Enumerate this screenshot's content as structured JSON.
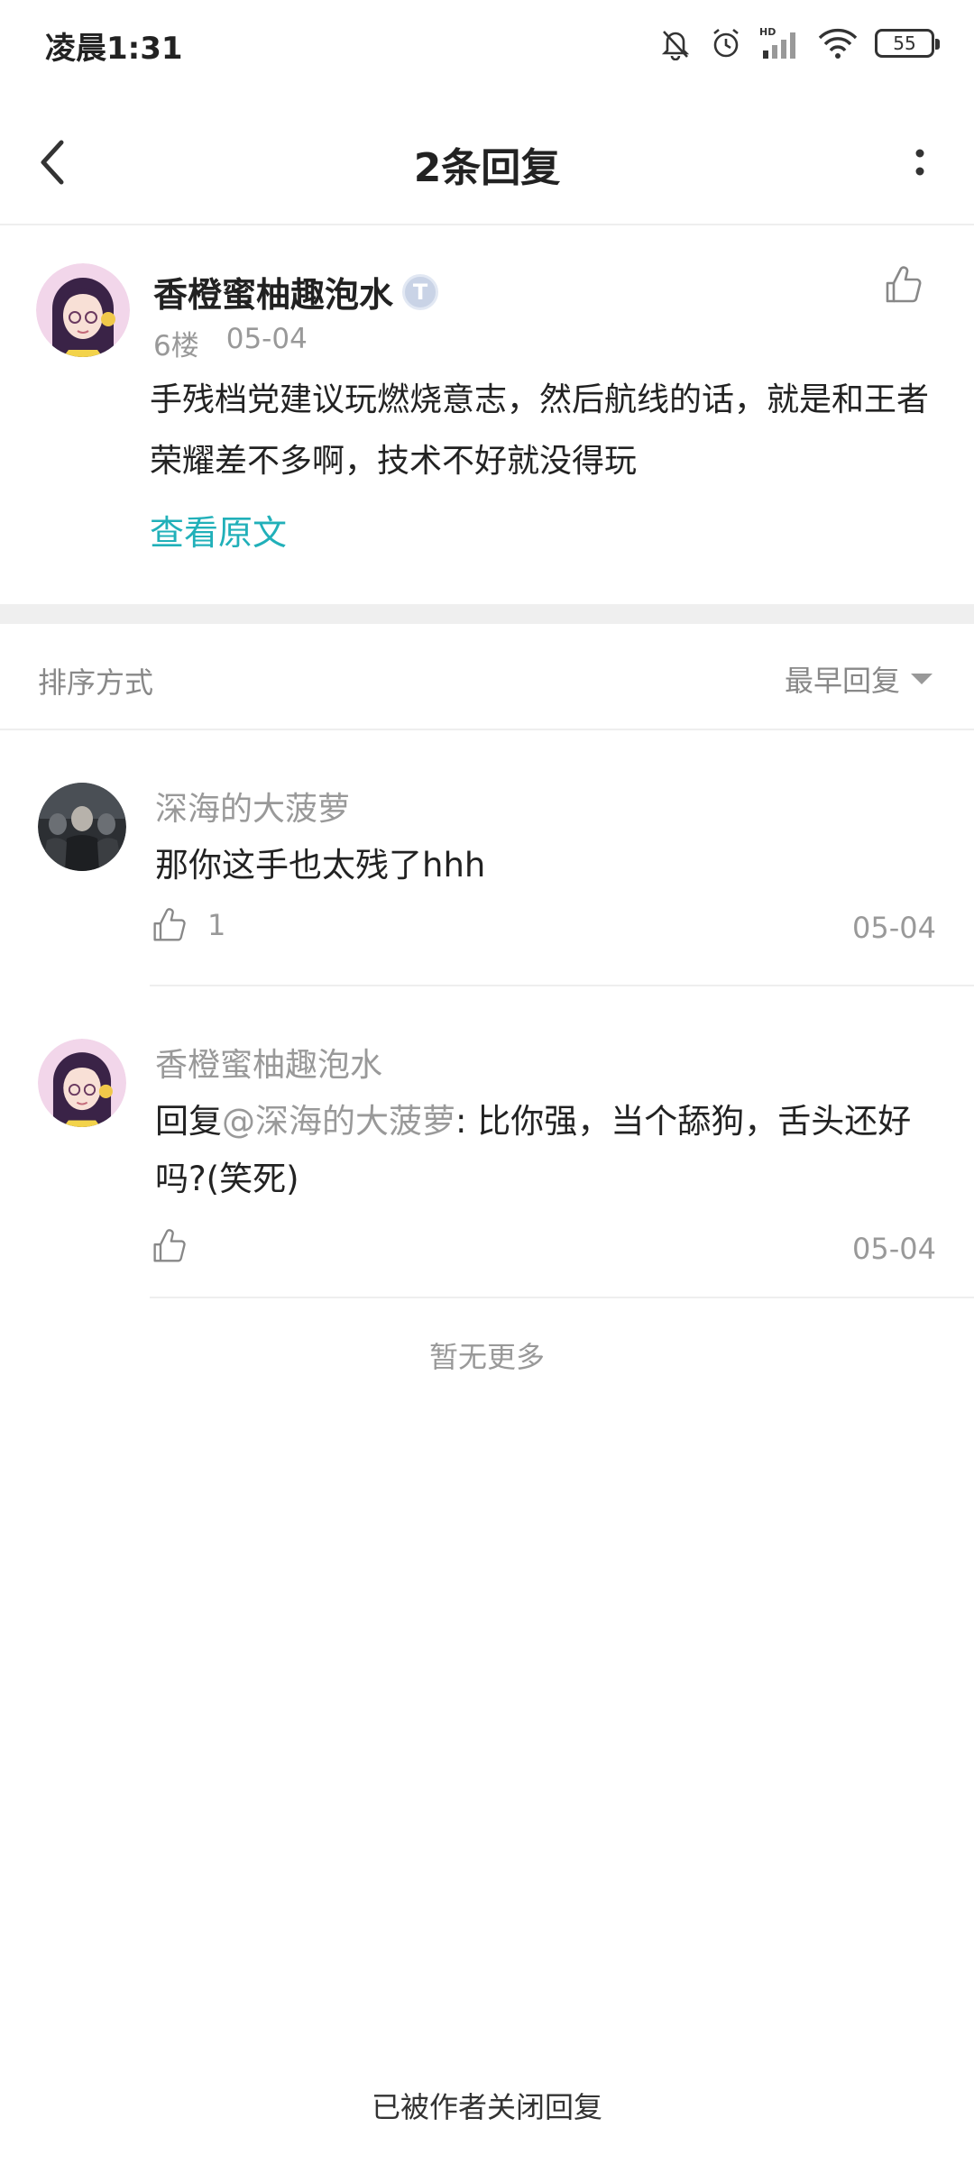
{
  "status_bar": {
    "time": "凌晨1:31",
    "battery": "55",
    "network_label": "HD"
  },
  "header": {
    "title": "2条回复"
  },
  "post": {
    "author": "香橙蜜柚趣泡水",
    "badge": "T",
    "floor": "6楼",
    "date": "05-04",
    "content": "手残档党建议玩燃烧意志，然后航线的话，就是和王者荣耀差不多啊，技术不好就没得玩",
    "view_original": "查看原文"
  },
  "sort": {
    "label": "排序方式",
    "selected": "最早回复"
  },
  "replies": [
    {
      "author": "深海的大菠萝",
      "text": "那你这手也太残了hhh",
      "likes": "1",
      "date": "05-04"
    },
    {
      "author": "香橙蜜柚趣泡水",
      "prefix": "回复",
      "mention": "@深海的大菠萝",
      "text": ": 比你强，当个舔狗，舌头还好吗?(笑死)",
      "likes": "",
      "date": "05-04"
    }
  ],
  "footer": {
    "no_more": "暂无更多",
    "closed": "已被作者关闭回复"
  },
  "colors": {
    "accent": "#21b0b9",
    "muted_text": "#999999",
    "divider": "#eeeeee"
  }
}
